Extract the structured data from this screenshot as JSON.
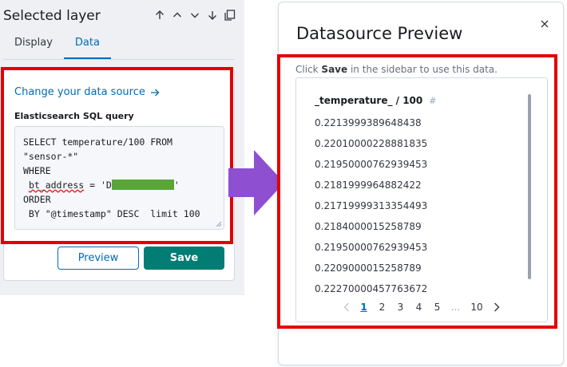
{
  "left_panel": {
    "title": "Selected layer",
    "tabs": [
      {
        "label": "Display",
        "active": false
      },
      {
        "label": "Data",
        "active": true
      }
    ],
    "change_source_link": "Change your data source",
    "sql_label": "Elasticsearch SQL query",
    "sql_lines": {
      "l1": "SELECT temperature/100 FROM",
      "l2": "\"sensor-*\"",
      "l3": "WHERE",
      "l4_field": "bt_address",
      "l4_prefix": " = 'D",
      "l4_suffix": "'",
      "l5": "ORDER",
      "l6": " BY \"@timestamp\" DESC  limit 100"
    },
    "preview_button": "Preview",
    "save_button": "Save"
  },
  "modal": {
    "title": "Datasource Preview",
    "hint_prefix": "Click ",
    "hint_bold": "Save",
    "hint_suffix": " in the sidebar to use this data.",
    "column_header": "_temperature_ / 100",
    "column_type_symbol": "#",
    "rows": [
      "0.2213999389648438",
      "0.22010000228881835",
      "0.21950000762939453",
      "0.2181999964882422",
      "0.21719999313354493",
      "0.2184000015258789",
      "0.21950000762939453",
      "0.2209000015258789",
      "0.22270000457763672"
    ],
    "pagination": [
      "1",
      "2",
      "3",
      "4",
      "5",
      "...",
      "10"
    ],
    "active_page": "1"
  },
  "colors": {
    "accent": "#006bb8",
    "save_green": "#017d73",
    "highlight_red": "#e30000",
    "arrow_purple": "#8e4fd1",
    "redaction_green": "#5aa53a"
  }
}
